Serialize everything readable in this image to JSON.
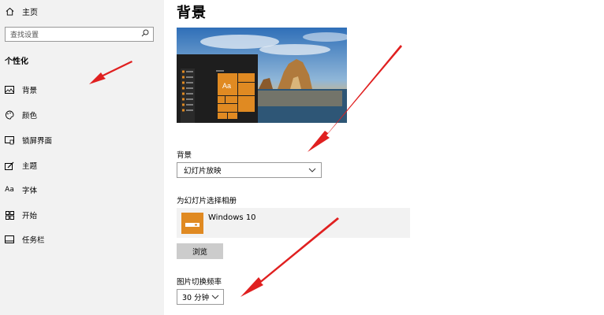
{
  "sidebar": {
    "home_label": "主页",
    "search_placeholder": "查找设置",
    "section_title": "个性化",
    "items": [
      {
        "label": "背景",
        "icon": "picture-icon"
      },
      {
        "label": "颜色",
        "icon": "palette-icon"
      },
      {
        "label": "锁屏界面",
        "icon": "lock-screen-icon"
      },
      {
        "label": "主题",
        "icon": "theme-icon"
      },
      {
        "label": "字体",
        "icon": "font-icon"
      },
      {
        "label": "开始",
        "icon": "start-icon"
      },
      {
        "label": "任务栏",
        "icon": "taskbar-icon"
      }
    ]
  },
  "main": {
    "title": "背景",
    "preview_tile_text": "Aa",
    "background_label": "背景",
    "background_value": "幻灯片放映",
    "album_label": "为幻灯片选择相册",
    "album_name": "Windows 10",
    "browse_label": "浏览",
    "frequency_label": "图片切换频率",
    "frequency_value": "30 分钟"
  },
  "colors": {
    "sidebar_bg": "#f2f2f2",
    "tile_accent": "#e08a22",
    "annotation_arrow": "#e02020"
  }
}
